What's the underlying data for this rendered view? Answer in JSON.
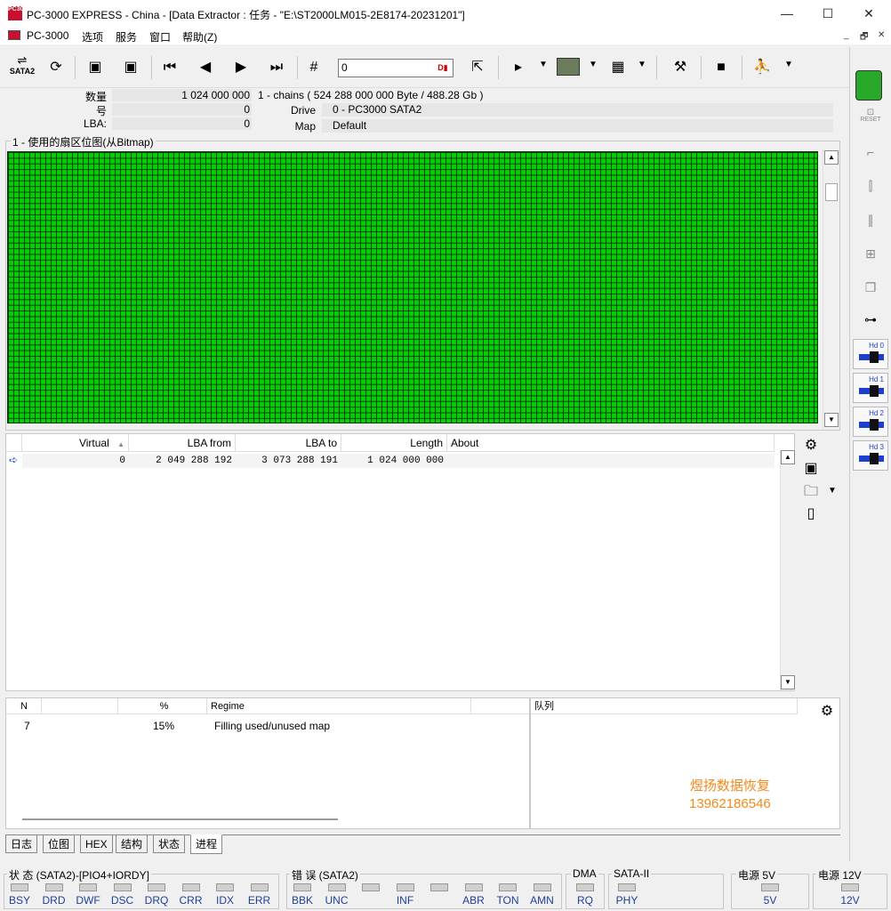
{
  "window": {
    "icon_text": "PC3000",
    "title": "PC-3000 EXPRESS - China - [Data Extractor : 任务 - \"E:\\ST2000LM015-2E8174-20231201\"]",
    "minimize": "—",
    "maximize": "☐",
    "close": "✕"
  },
  "menu": {
    "items": [
      "PC-3000",
      "选项",
      "服务",
      "窗口",
      "帮助(Z)"
    ],
    "mdi_buttons": [
      "_",
      "🗗",
      "✕"
    ]
  },
  "toolbar": {
    "sata_label": "SATA2",
    "lba_value": "0",
    "go_label": "D▮",
    "icons": [
      "drive-icon",
      "refresh-icon",
      "save-map-icon",
      "load-map-icon",
      "first-icon",
      "prev-icon",
      "next-icon",
      "last-icon",
      "goto-icon",
      "export-icon",
      "play-icon",
      "thumbnail-icon",
      "grid-icon",
      "tools-icon",
      "stop-icon",
      "run-icon"
    ]
  },
  "info": {
    "count_label": "数量",
    "count_value": "1 024 000 000",
    "chains_text": "1 - chains  ( 524 288 000 000 Byte /  488.28 Gb )",
    "num_label": "号",
    "num_value": "0",
    "lba_label": "LBA:",
    "lba_value": "0",
    "drive_label": "Drive",
    "drive_value": "0 - PC3000 SATA2",
    "map_label": "Map",
    "map_value": "Default"
  },
  "bitmap": {
    "legend": "1 - 使用的扇区位图(从Bitmap)",
    "used_color": "#00d000",
    "fill_fraction": 1.0
  },
  "chains_table": {
    "columns": [
      "Virtual",
      "LBA from",
      "LBA to",
      "Length",
      "About"
    ],
    "sort_indicator": "▲",
    "rows": [
      {
        "virtual": "0",
        "lba_from": "2 049 288 192",
        "lba_to": "3 073 288 191",
        "length": "1 024 000 000",
        "about": ""
      }
    ]
  },
  "process": {
    "columns": [
      "N",
      "",
      "%",
      "Regime",
      ""
    ],
    "rows": [
      {
        "n": "7",
        "percent": "15%",
        "regime": "Filling used/unused map"
      }
    ]
  },
  "queue": {
    "title": "队列",
    "watermark_line1": "煜扬数据恢复",
    "watermark_line2": "13962186546"
  },
  "tabs": [
    {
      "label": "日志",
      "active": false
    },
    {
      "label": "位图",
      "active": false
    },
    {
      "label": "HEX",
      "active": false
    },
    {
      "label": "结构",
      "active": false
    },
    {
      "label": "状态",
      "active": false
    },
    {
      "label": "进程",
      "active": true
    }
  ],
  "status": {
    "state_title": "状 态 (SATA2)-[PIO4+IORDY]",
    "state_leds": [
      "BSY",
      "DRD",
      "DWF",
      "DSC",
      "DRQ",
      "CRR",
      "IDX",
      "ERR"
    ],
    "error_title": "错 误 (SATA2)",
    "error_leds": [
      "BBK",
      "UNC",
      "",
      "INF",
      "",
      "ABR",
      "TON",
      "AMN"
    ],
    "dma_title": "DMA",
    "dma_leds": [
      "RQ"
    ],
    "sata_title": "SATA-II",
    "sata_leds": [
      "PHY"
    ],
    "power5_title": "电源 5V",
    "power5_leds": [
      "5V"
    ],
    "power12_title": "电源 12V",
    "power12_leds": [
      "12V"
    ]
  },
  "right_panel": {
    "reset_label": "RESET",
    "hd_buttons": [
      "Hd 0",
      "Hd 1",
      "Hd 2",
      "Hd 3"
    ]
  }
}
